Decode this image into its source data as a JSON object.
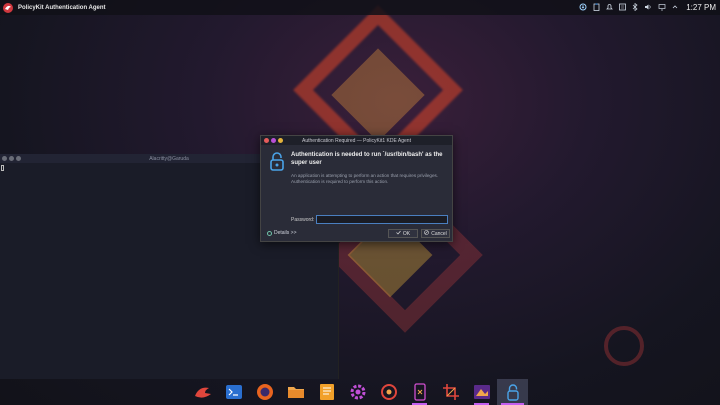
{
  "topbar": {
    "app_title": "PolicyKit Authentication Agent",
    "clock": "1:27 PM",
    "tray_icons": [
      "updates-icon",
      "clipboard-icon",
      "notifications-icon",
      "settings-icon",
      "bluetooth-icon",
      "volume-icon",
      "network-icon",
      "expand-icon"
    ]
  },
  "terminal": {
    "title": "Alacritty@Garuda"
  },
  "dialog": {
    "title": "Authentication Required — PolicyKit1 KDE Agent",
    "heading": "Authentication is needed to run `/usr/bin/bash' as the super user",
    "description": "An application is attempting to perform an action that requires privileges. Authentication is required to perform this action.",
    "password_label": "Password:",
    "password_value": "",
    "details_label": "Details >>",
    "ok_label": "OK",
    "cancel_label": "Cancel"
  },
  "dock": {
    "items": [
      "garuda-menu-icon",
      "terminal-icon",
      "firefox-icon",
      "folder-icon",
      "text-editor-icon",
      "settings-gear-icon",
      "music-icon",
      "phone-icon",
      "crop-tool-icon",
      "photo-viewer-icon",
      "lock-auth-icon"
    ]
  },
  "colors": {
    "accent": "#c35ef0",
    "dialog_bg": "#2a2c38",
    "focus": "#4a7fc0"
  }
}
